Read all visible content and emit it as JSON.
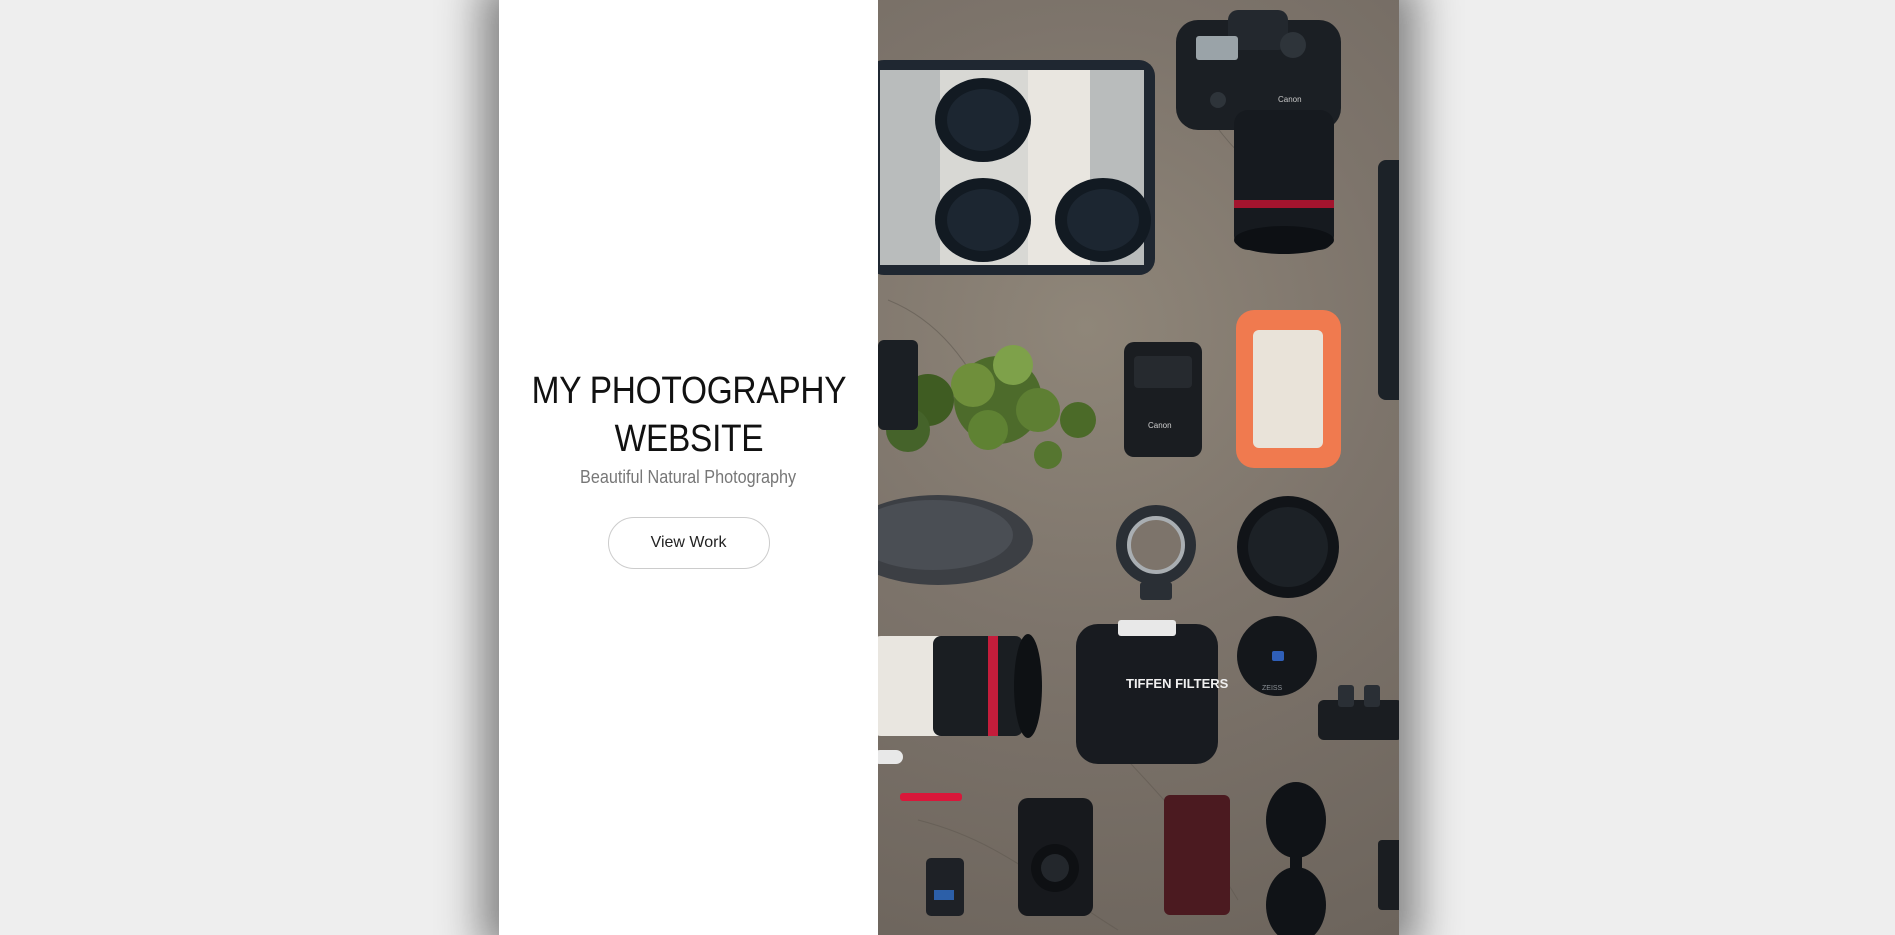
{
  "hero": {
    "title": "MY PHOTOGRAPHY WEBSITE",
    "subtitle": "Beautiful Natural Photography",
    "button_label": "View Work"
  },
  "photo": {
    "subject": "flat-lay of camera gear",
    "labels": {
      "camera_brand": "Canon",
      "charger_brand": "Canon",
      "filter_pouch_brand": "TIFFEN FILTERS",
      "lens_cap_brand": "ZEISS"
    }
  },
  "colors": {
    "background": "#eeeeee",
    "panel": "#ffffff",
    "title": "#111111",
    "subtitle": "#777777",
    "button_border": "#cccccc",
    "hard_drive_orange": "#f07a4f"
  }
}
